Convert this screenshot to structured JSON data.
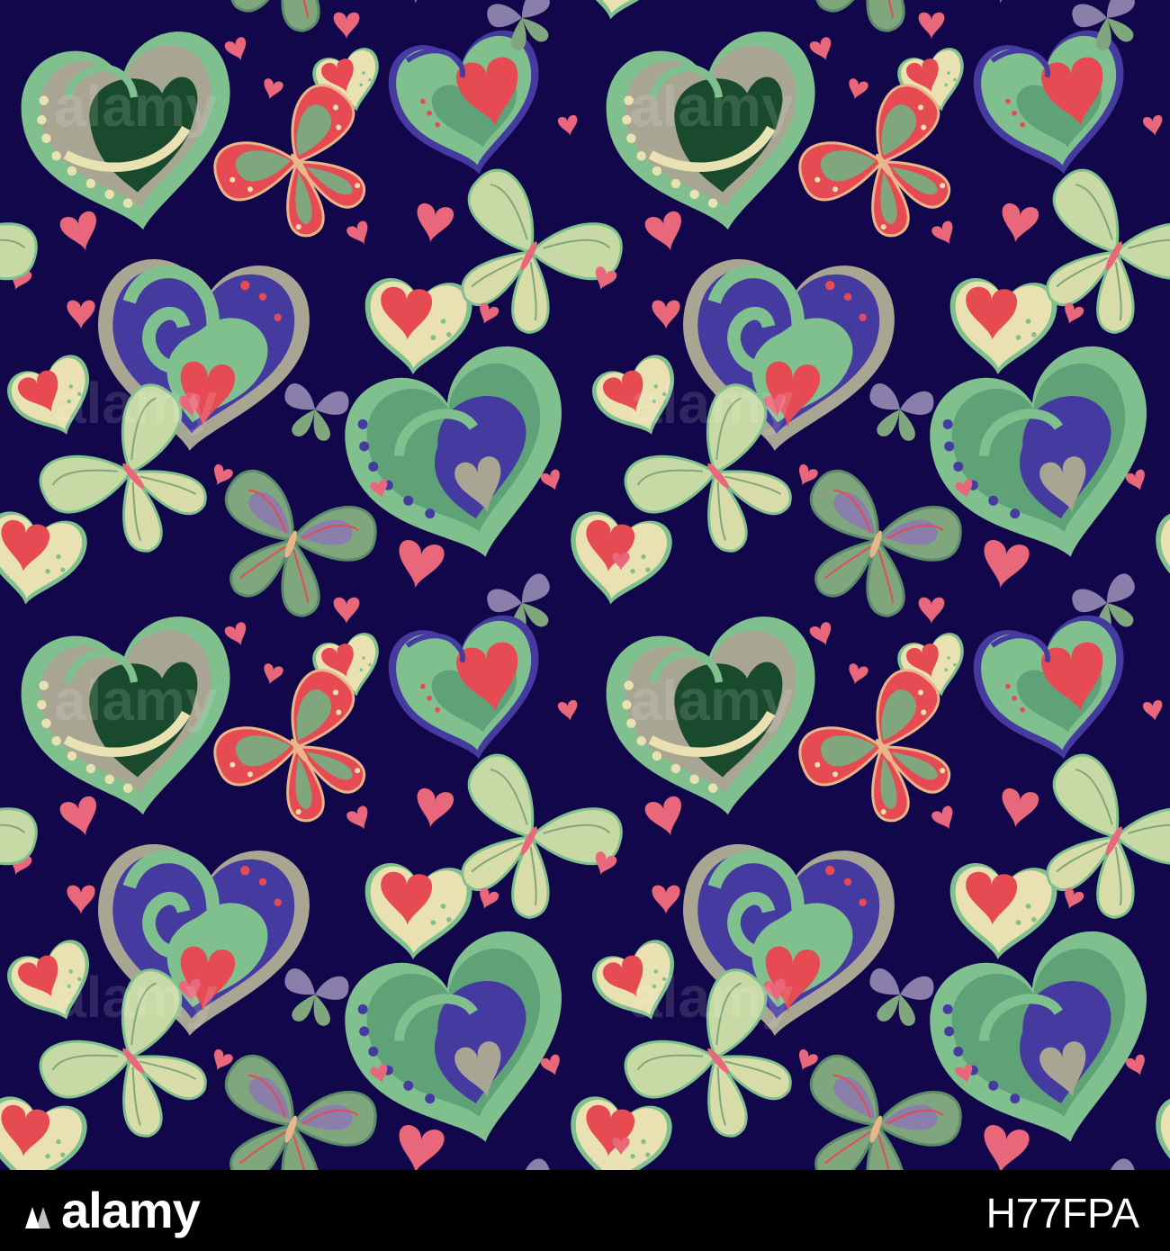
{
  "photo": {
    "name": "seamless pattern with hand drawn hearts and butterflies",
    "background_color": "#12074a",
    "palette": [
      "#12074a",
      "#7fc08e",
      "#e9e1b1",
      "#e64a52",
      "#e9677a",
      "#1a4a2d",
      "#453aa0",
      "#a9a593",
      "#8a7eaa"
    ]
  },
  "watermark": {
    "text": "alamy"
  },
  "footer": {
    "brand": "alamy",
    "stock_id": "H77FPA"
  }
}
